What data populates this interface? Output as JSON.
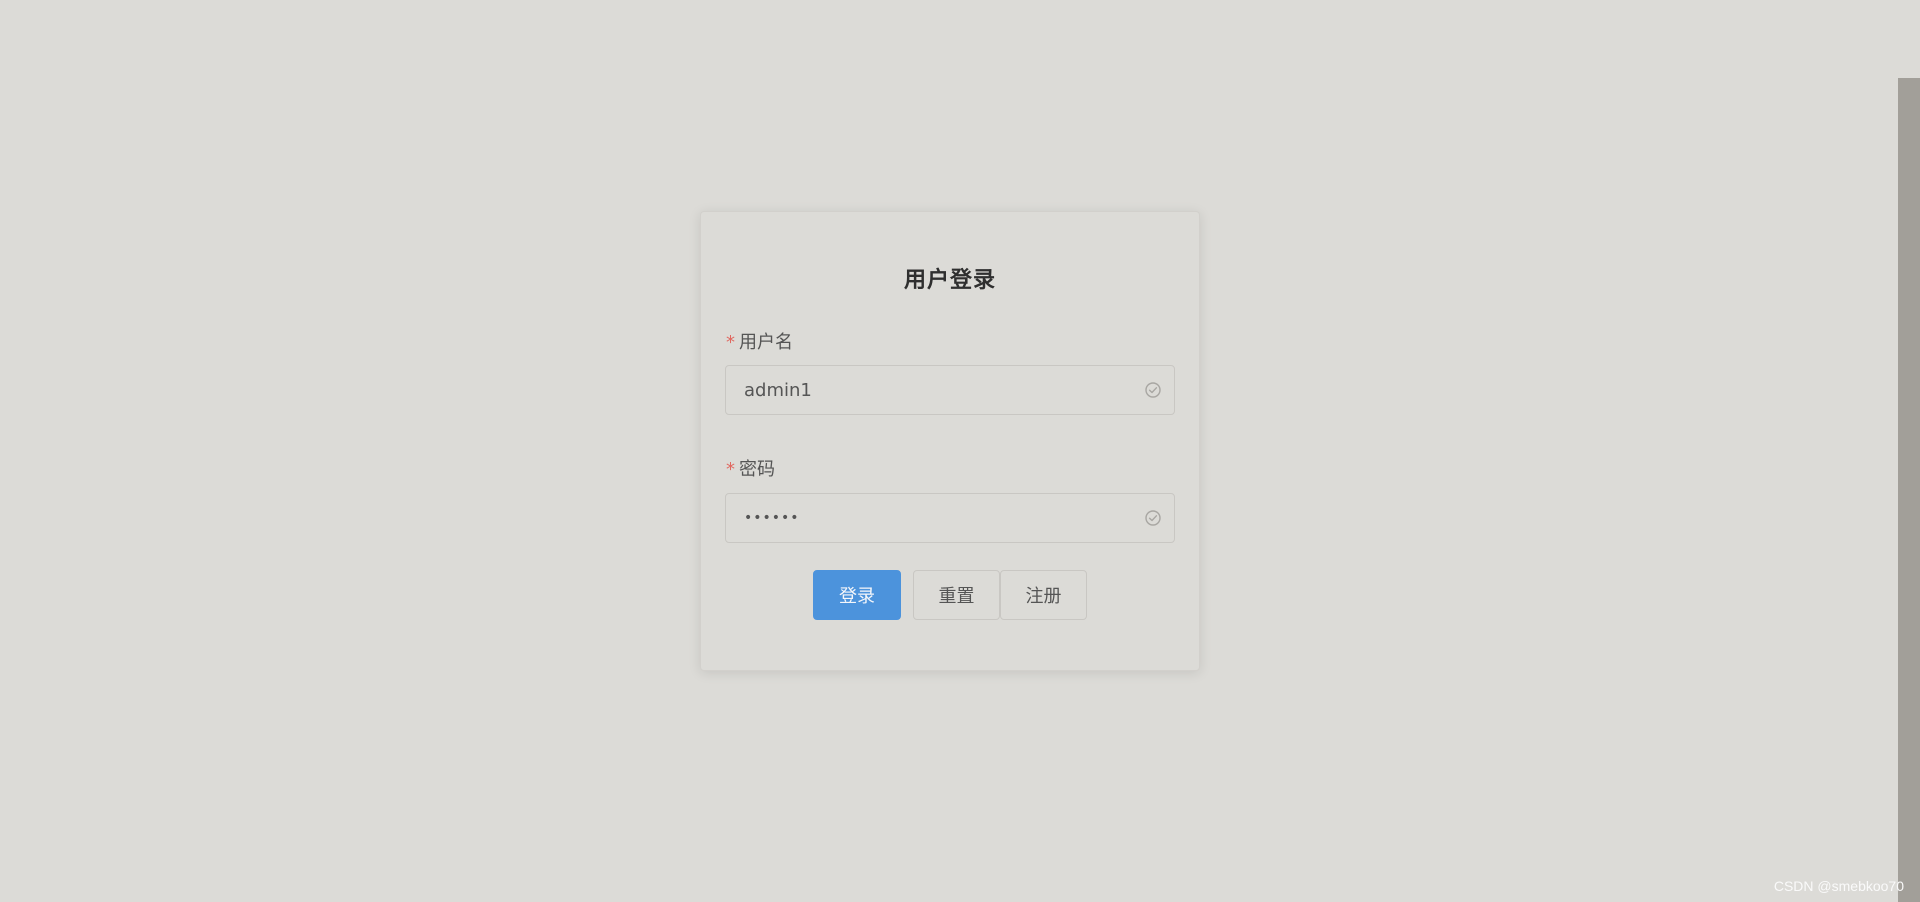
{
  "login": {
    "title": "用户登录",
    "username_label": "用户名",
    "username_value": "admin1",
    "password_label": "密码",
    "password_dots": "••••••",
    "required_mark": "*",
    "login_button": "登录",
    "reset_button": "重置",
    "register_button": "注册"
  },
  "watermark": "CSDN @smebkoo70",
  "colors": {
    "background": "#dcdbd7",
    "primary": "#4c93dc",
    "required": "#e0675f"
  },
  "icons": {
    "input_valid": "circle-check-icon"
  }
}
